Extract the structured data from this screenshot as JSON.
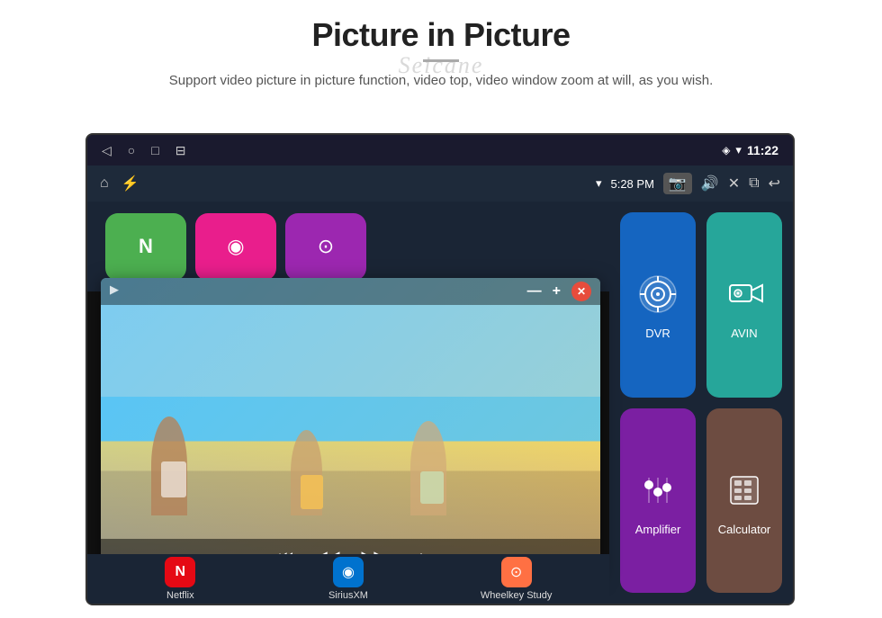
{
  "header": {
    "title": "Picture in Picture",
    "watermark": "Seicane",
    "subtitle": "Support video picture in picture function, video top, video window zoom at will, as you wish.",
    "divider": true
  },
  "device": {
    "statusBar": {
      "time": "11:22",
      "navIcons": [
        "◁",
        "○",
        "□",
        "⊟"
      ],
      "rightIcons": [
        "location",
        "wifi",
        "time"
      ]
    },
    "appBar": {
      "leftIcons": [
        "home",
        "usb"
      ],
      "rightIcons": [
        "wifi",
        "time_appbar",
        "camera",
        "volume",
        "close",
        "pip",
        "back"
      ],
      "wifiLabel": "5:28 PM"
    }
  },
  "pipWindow": {
    "controls": {
      "minus": "—",
      "plus": "+",
      "close": "✕"
    },
    "playbackControls": [
      "⏮",
      "◀◀",
      "▶▶",
      "⏭"
    ]
  },
  "apps": {
    "topRow": [
      {
        "id": "netflix-top",
        "color": "green",
        "label": ""
      },
      {
        "id": "sirius-top",
        "color": "pink",
        "label": ""
      },
      {
        "id": "wheelkey-top",
        "color": "purple",
        "label": ""
      }
    ],
    "rightGrid": [
      {
        "id": "dvr",
        "label": "DVR",
        "color": "blue",
        "icon": "📡"
      },
      {
        "id": "avin",
        "label": "AVIN",
        "color": "teal",
        "icon": "🎬"
      },
      {
        "id": "amplifier",
        "label": "Amplifier",
        "color": "purple",
        "icon": "🎚"
      },
      {
        "id": "calculator",
        "label": "Calculator",
        "color": "brown",
        "icon": "🧮"
      }
    ],
    "bottomRow": [
      {
        "id": "netflix",
        "label": "Netflix",
        "color": "netflix",
        "icon": "N"
      },
      {
        "id": "siriusxm",
        "label": "SiriusXM",
        "color": "sirius",
        "icon": "◉"
      },
      {
        "id": "wheelkey",
        "label": "Wheelkey Study",
        "color": "wheelkey",
        "icon": "⊙"
      }
    ]
  }
}
